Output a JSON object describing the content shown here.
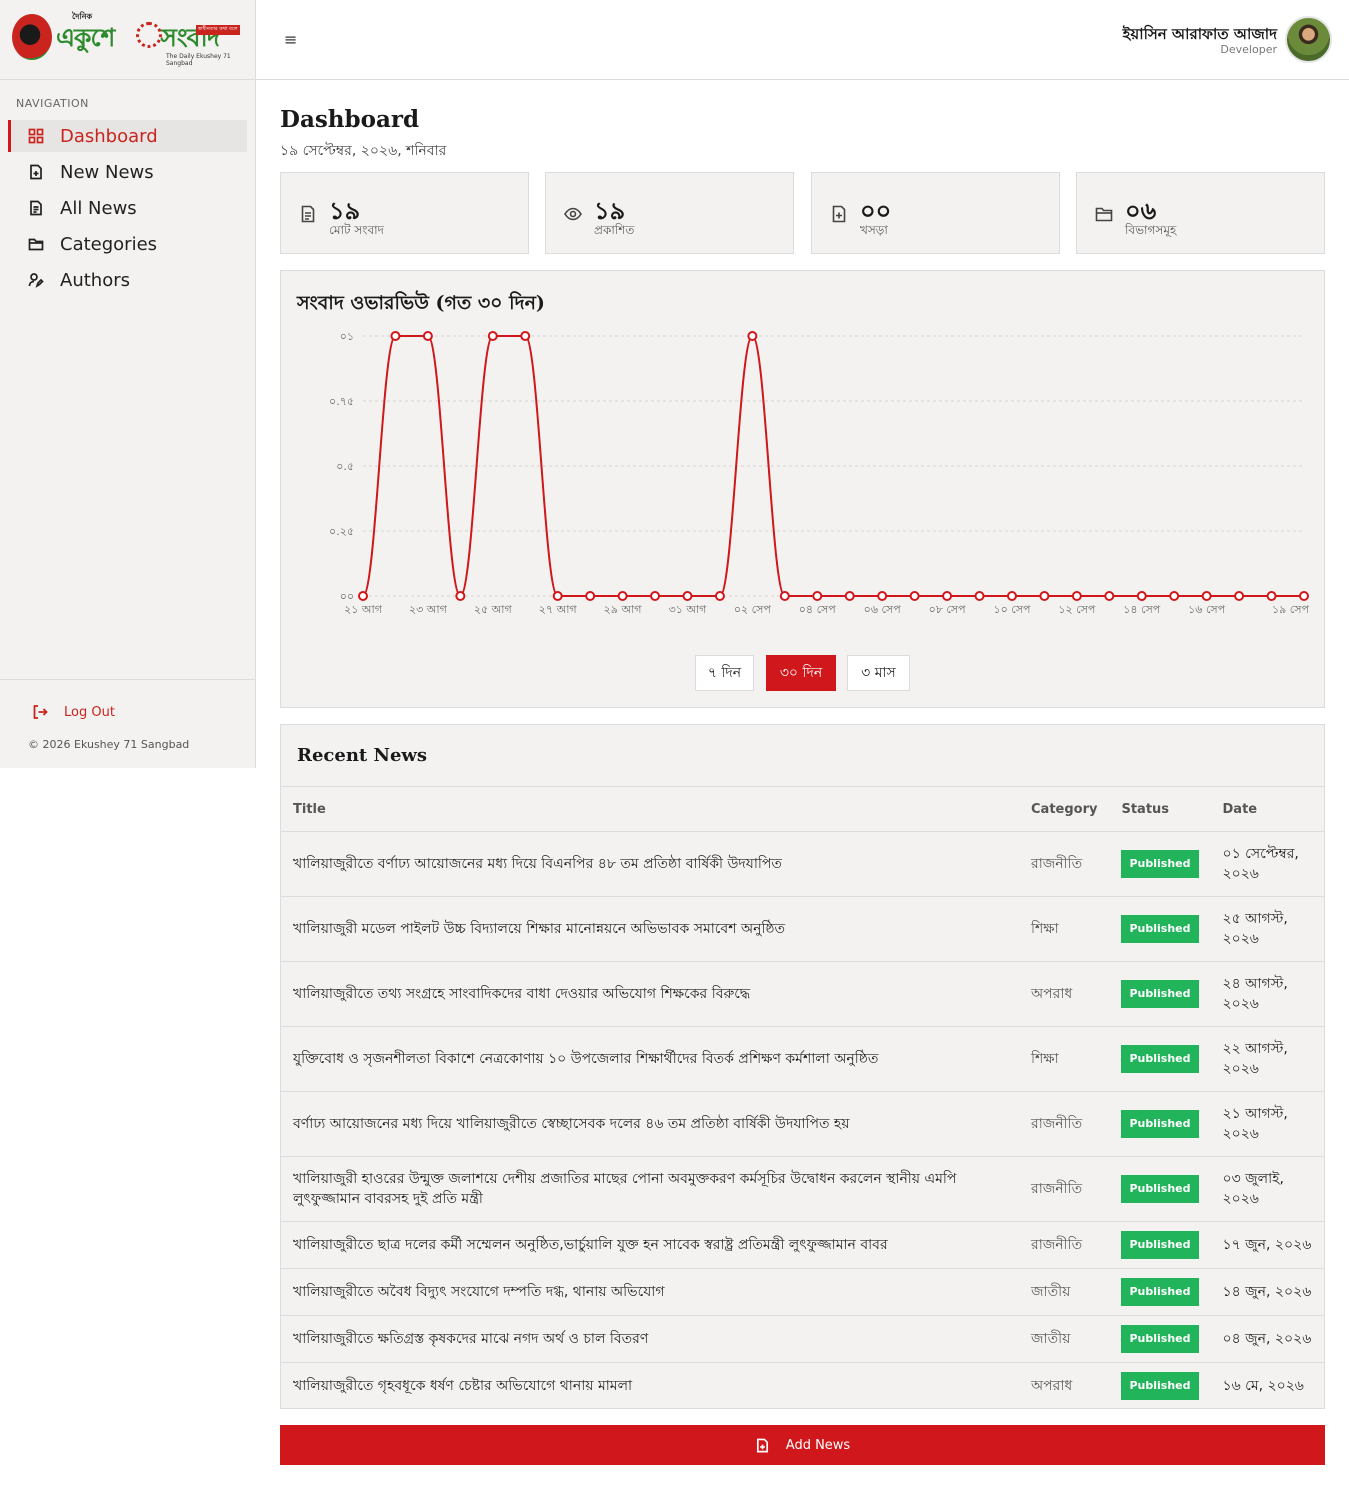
{
  "brand": {
    "small": "দৈনিক",
    "name_part1": "একুশে",
    "name_part2": "সংবাদ",
    "tagline": "স্বাধীনতার কথা বলে",
    "sub": "The Daily Ekushey 71 Sangbad"
  },
  "sidebar": {
    "heading": "NAVIGATION",
    "items": [
      {
        "label": "Dashboard",
        "icon": "grid-icon",
        "active": true
      },
      {
        "label": "New News",
        "icon": "file-plus-icon",
        "active": false
      },
      {
        "label": "All News",
        "icon": "file-text-icon",
        "active": false
      },
      {
        "label": "Categories",
        "icon": "folder-icon",
        "active": false
      },
      {
        "label": "Authors",
        "icon": "user-pen-icon",
        "active": false
      }
    ],
    "logout": "Log Out",
    "copyright": "© 2026 Ekushey 71 Sangbad"
  },
  "header": {
    "menu_icon": "≡",
    "user_name": "ইয়াসিন আরাফাত আজাদ",
    "user_role": "Developer"
  },
  "page": {
    "title": "Dashboard",
    "date": "১৯ সেপ্টেম্বর, ২০২৬, শনিবার"
  },
  "stats": [
    {
      "value": "১৯",
      "label": "মোট সংবাদ",
      "icon": "file-text-icon"
    },
    {
      "value": "১৯",
      "label": "প্রকাশিত",
      "icon": "eye-icon"
    },
    {
      "value": "০০",
      "label": "খসড়া",
      "icon": "file-plus-icon"
    },
    {
      "value": "০৬",
      "label": "বিভাগসমূহ",
      "icon": "folder-icon"
    }
  ],
  "chart_data": {
    "type": "line",
    "title": "সংবাদ ওভারভিউ (গত ৩০ দিন)",
    "ylim": [
      0,
      1
    ],
    "y_ticks": [
      {
        "v": 0,
        "label": "০০"
      },
      {
        "v": 0.25,
        "label": "০.২৫"
      },
      {
        "v": 0.5,
        "label": "০.৫"
      },
      {
        "v": 0.75,
        "label": "০.৭৫"
      },
      {
        "v": 1,
        "label": "০১"
      }
    ],
    "x": [
      "২১ আগ",
      "২২ আগ",
      "২৩ আগ",
      "২৪ আগ",
      "২৫ আগ",
      "২৬ আগ",
      "২৭ আগ",
      "২৮ আগ",
      "২৯ আগ",
      "৩০ আগ",
      "৩১ আগ",
      "০১ সেপ",
      "০২ সেপ",
      "০৩ সেপ",
      "০৪ সেপ",
      "০৫ সেপ",
      "০৬ সেপ",
      "০৭ সেপ",
      "০৮ সেপ",
      "০৯ সেপ",
      "১০ সেপ",
      "১১ সেপ",
      "১২ সেপ",
      "১৩ সেপ",
      "১৪ সেপ",
      "১৫ সেপ",
      "১৬ সেপ",
      "১৭ সেপ",
      "১৮ সেপ",
      "১৯ সেপ"
    ],
    "x_tick_labels": [
      "২১ আগ",
      "২৩ আগ",
      "২৫ আগ",
      "২৭ আগ",
      "২৯ আগ",
      "৩১ আগ",
      "০২ সেপ",
      "০৪ সেপ",
      "০৬ সেপ",
      "০৮ সেপ",
      "১০ সেপ",
      "১২ সেপ",
      "১৪ সেপ",
      "১৬ সেপ",
      "১৯ সেপ"
    ],
    "series": [
      {
        "values": [
          0,
          1,
          1,
          0,
          1,
          1,
          0,
          0,
          0,
          0,
          0,
          0,
          1,
          0,
          0,
          0,
          0,
          0,
          0,
          0,
          0,
          0,
          0,
          0,
          0,
          0,
          0,
          0,
          0,
          0
        ]
      }
    ],
    "grid": true,
    "color": "#d0171b"
  },
  "range_buttons": [
    {
      "label": "৭ দিন",
      "active": false
    },
    {
      "label": "৩০ দিন",
      "active": true
    },
    {
      "label": "৩ মাস",
      "active": false
    }
  ],
  "recent": {
    "title": "Recent News",
    "columns": [
      "Title",
      "Category",
      "Status",
      "Date"
    ],
    "rows": [
      {
        "title": "খালিয়াজুরীতে বর্ণাঢ্য আয়োজনের মধ্য দিয়ে বিএনপির ৪৮ তম প্রতিষ্ঠা বার্ষিকী উদযাপিত",
        "category": "রাজনীতি",
        "status": "Published",
        "date": "০১ সেপ্টেম্বর, ২০২৬"
      },
      {
        "title": "খালিয়াজুরী মডেল পাইলট উচ্চ বিদ্যালয়ে শিক্ষার মানোন্নয়নে অভিভাবক সমাবেশ অনুষ্ঠিত",
        "category": "শিক্ষা",
        "status": "Published",
        "date": "২৫ আগস্ট, ২০২৬"
      },
      {
        "title": "খালিয়াজুরীতে তথ্য সংগ্রহে সাংবাদিকদের বাধা দেওয়ার অভিযোগ শিক্ষকের বিরুদ্ধে",
        "category": "অপরাধ",
        "status": "Published",
        "date": "২৪ আগস্ট, ২০২৬"
      },
      {
        "title": "যুক্তিবোধ ও সৃজনশীলতা বিকাশে নেত্রকোণায় ১০ উপজেলার শিক্ষার্থীদের বিতর্ক প্রশিক্ষণ কর্মশালা অনুষ্ঠিত",
        "category": "শিক্ষা",
        "status": "Published",
        "date": "২২ আগস্ট, ২০২৬"
      },
      {
        "title": "বর্ণাঢ্য আয়োজনের মধ্য দিয়ে খালিয়াজুরীতে স্বেচ্ছাসেবক দলের ৪৬ তম প্রতিষ্ঠা বার্ষিকী উদযাপিত হয়",
        "category": "রাজনীতি",
        "status": "Published",
        "date": "২১ আগস্ট, ২০২৬"
      },
      {
        "title": "খালিয়াজুরী হাওরের উন্মুক্ত জলাশয়ে দেশীয় প্রজাতির মাছের পোনা অবমুক্তকরণ কর্মসূচির উদ্বোধন করলেন স্থানীয় এমপি লুৎফুজ্জামান বাবরসহ দুই প্রতি মন্ত্রী",
        "category": "রাজনীতি",
        "status": "Published",
        "date": "০৩ জুলাই, ২০২৬"
      },
      {
        "title": "খালিয়াজুরীতে ছাত্র দলের কর্মী সম্মেলন অনুষ্ঠিত,ভার্চুয়ালি যুক্ত হন সাবেক স্বরাষ্ট্র প্রতিমন্ত্রী লুৎফুজ্জামান বাবর",
        "category": "রাজনীতি",
        "status": "Published",
        "date": "১৭ জুন, ২০২৬"
      },
      {
        "title": "খালিয়াজুরীতে অবৈধ বিদ্যুৎ সংযোগে দম্পতি দগ্ধ, থানায় অভিযোগ",
        "category": "জাতীয়",
        "status": "Published",
        "date": "১৪ জুন, ২০২৬"
      },
      {
        "title": "খালিয়াজুরীতে ক্ষতিগ্রস্ত কৃষকদের মাঝে নগদ অর্থ ও চাল বিতরণ",
        "category": "জাতীয়",
        "status": "Published",
        "date": "০৪ জুন, ২০২৬"
      },
      {
        "title": "খালিয়াজুরীতে গৃহবধূকে ধর্ষণ চেষ্টার অভিযোগে থানায় মামলা",
        "category": "অপরাধ",
        "status": "Published",
        "date": "১৬ মে, ২০২৬"
      }
    ]
  },
  "add_news": {
    "label": "Add News",
    "icon": "file-plus-icon"
  },
  "colors": {
    "accent": "#d0171b",
    "success": "#21b45a",
    "panel": "#f3f2f0"
  }
}
